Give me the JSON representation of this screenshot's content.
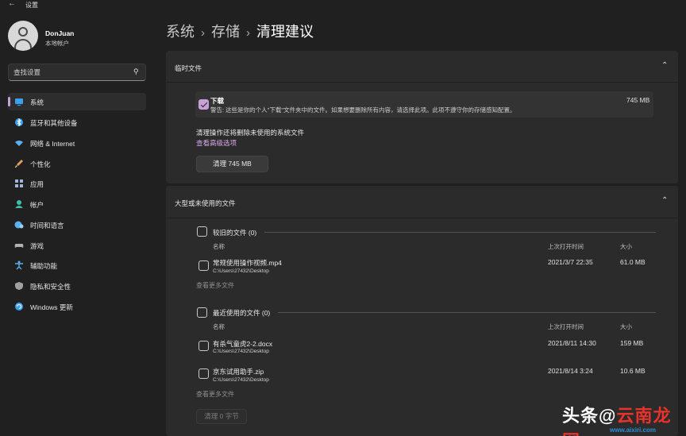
{
  "window": {
    "title": "设置",
    "back_icon": "back-arrow-icon"
  },
  "profile": {
    "name": "DonJuan",
    "account_type": "本地帐户"
  },
  "search": {
    "placeholder": "查找设置"
  },
  "sidebar": {
    "items": [
      {
        "label": "系统",
        "icon": "monitor-icon",
        "color": "#3aa0f0",
        "selected": true
      },
      {
        "label": "蓝牙和其他设备",
        "icon": "bluetooth-icon",
        "color": "#3aa0f0",
        "selected": false
      },
      {
        "label": "网络 & Internet",
        "icon": "wifi-icon",
        "color": "#5ab0f0",
        "selected": false
      },
      {
        "label": "个性化",
        "icon": "brush-icon",
        "color": "#e0a060",
        "selected": false
      },
      {
        "label": "应用",
        "icon": "apps-icon",
        "color": "#a0b8d8",
        "selected": false
      },
      {
        "label": "帐户",
        "icon": "person-icon",
        "color": "#40c0a0",
        "selected": false
      },
      {
        "label": "时间和语言",
        "icon": "globe-clock-icon",
        "color": "#5ab0f0",
        "selected": false
      },
      {
        "label": "游戏",
        "icon": "gamepad-icon",
        "color": "#b0b0b0",
        "selected": false
      },
      {
        "label": "辅助功能",
        "icon": "accessibility-icon",
        "color": "#5ab0f0",
        "selected": false
      },
      {
        "label": "隐私和安全性",
        "icon": "shield-icon",
        "color": "#a0a0a0",
        "selected": false
      },
      {
        "label": "Windows 更新",
        "icon": "update-icon",
        "color": "#3aa0f0",
        "selected": false
      }
    ]
  },
  "breadcrumb": {
    "part1": "系统",
    "part2": "存储",
    "current": "清理建议"
  },
  "temp_files": {
    "title": "临时文件",
    "item": {
      "name": "下载",
      "warning": "警告: 这些是你的个人\"下载\"文件夹中的文件。如果想要删除所有内容，请选择此项。此项不遵守你的存储感知配置。",
      "size": "745 MB",
      "checked": true
    },
    "note": "清理操作还将删除未使用的系统文件",
    "advanced_link": "查看高级选项",
    "clean_button": "清理 745 MB"
  },
  "large_files": {
    "title": "大型或未使用的文件",
    "old_group": {
      "label": "较旧的文件 (0)",
      "col_name": "名称",
      "col_last_opened": "上次打开时间",
      "col_size": "大小",
      "files": [
        {
          "name": "常规使用操作视频.mp4",
          "path": "C:\\Users\\27432\\Desktop",
          "last_opened": "2021/3/7 22:35",
          "size": "61.0 MB"
        }
      ],
      "more": "查看更多文件"
    },
    "recent_group": {
      "label": "最近使用的文件 (0)",
      "col_name": "名称",
      "col_last_opened": "上次打开时间",
      "col_size": "大小",
      "files": [
        {
          "name": "有杀气童虎2-2.docx",
          "path": "C:\\Users\\27432\\Desktop",
          "last_opened": "2021/8/11 14:30",
          "size": "159 MB"
        },
        {
          "name": "京东试用助手.zip",
          "path": "C:\\Users\\27432\\Desktop",
          "last_opened": "2021/8/14 3:24",
          "size": "10.6 MB"
        }
      ],
      "more": "查看更多文件"
    },
    "clean_button": "清理 0 字节"
  },
  "watermark": {
    "prefix": "头条",
    "at": "@",
    "brand": "云南龙网",
    "url": "www.aixiri.com"
  },
  "colors": {
    "background": "#202020",
    "panel": "#2b2b2b",
    "accent": "#c8a0d8"
  }
}
